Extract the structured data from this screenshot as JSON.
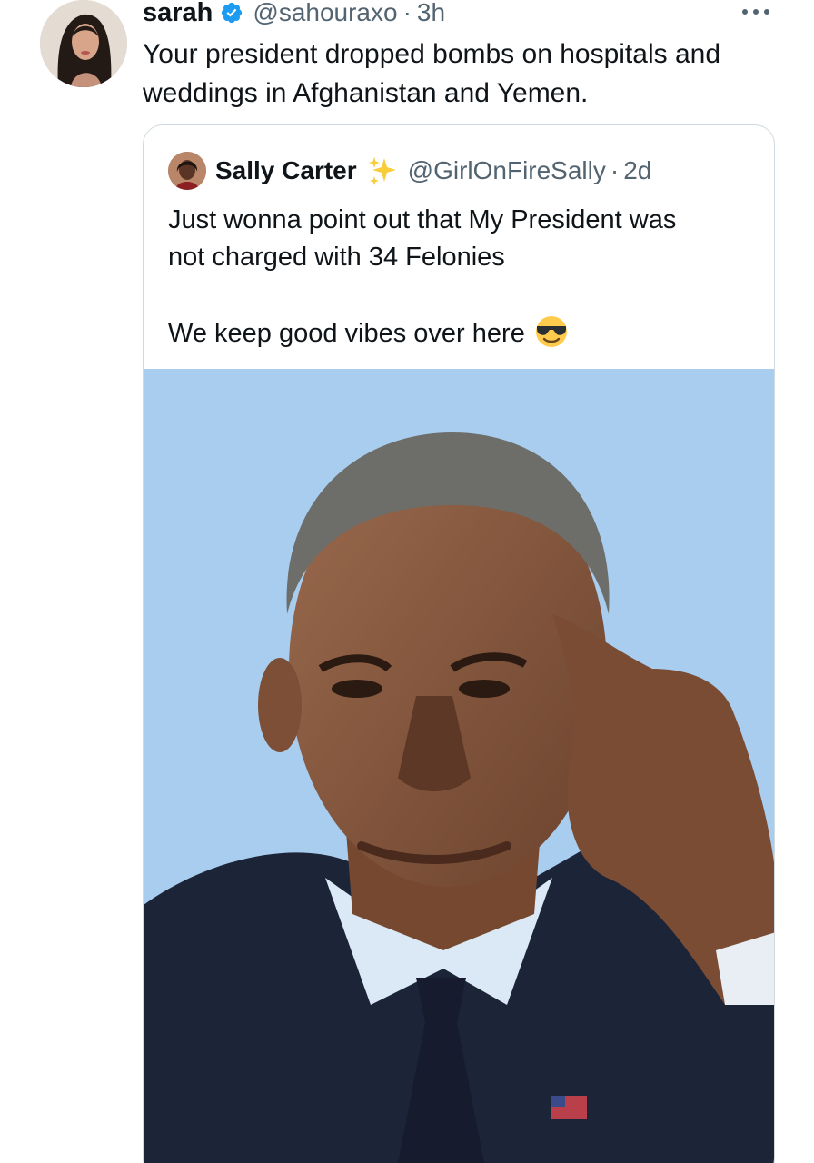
{
  "tweet": {
    "display_name": "sarah",
    "handle": "@sahouraxo",
    "separator": "·",
    "time": "3h",
    "text": "Your president dropped bombs on hospitals and weddings in Afghanistan and Yemen.",
    "more_icon": "more-horizontal-icon"
  },
  "quote": {
    "display_name": "Sally Carter",
    "handle": "@GirlOnFireSally",
    "separator": "·",
    "time": "2d",
    "text_line1": "Just wonna point out that My President was",
    "text_line2": "not charged with 34 Felonies",
    "text_line3": "We keep good vibes over here",
    "emoji": "smiling-face-with-sunglasses"
  },
  "colors": {
    "verified": "#1d9bf0",
    "secondary_text": "#536471",
    "border": "#cfd9de",
    "photo_background": "#a9cdee"
  }
}
